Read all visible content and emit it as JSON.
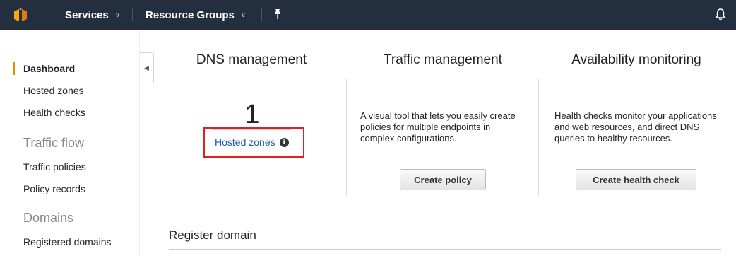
{
  "topnav": {
    "services_label": "Services",
    "resource_groups_label": "Resource Groups"
  },
  "sidebar": {
    "items": [
      {
        "label": "Dashboard",
        "active": true
      },
      {
        "label": "Hosted zones"
      },
      {
        "label": "Health checks"
      }
    ],
    "sections": [
      {
        "title": "Traffic flow",
        "items": [
          {
            "label": "Traffic policies"
          },
          {
            "label": "Policy records"
          }
        ]
      },
      {
        "title": "Domains",
        "items": [
          {
            "label": "Registered domains"
          }
        ]
      }
    ]
  },
  "main": {
    "dns": {
      "title": "DNS management",
      "count": "1",
      "link": "Hosted zones"
    },
    "traffic": {
      "title": "Traffic management",
      "description": "A visual tool that lets you easily create policies for multiple endpoints in complex configurations.",
      "button": "Create policy"
    },
    "availability": {
      "title": "Availability monitoring",
      "description": "Health checks monitor your applications and web resources, and direct DNS queries to healthy resources.",
      "button": "Create health check"
    },
    "register": {
      "title": "Register domain"
    }
  },
  "colors": {
    "nav_bg": "#232f3e",
    "accent": "#e88b00",
    "link": "#1a58b5",
    "highlight": "#e02020"
  }
}
